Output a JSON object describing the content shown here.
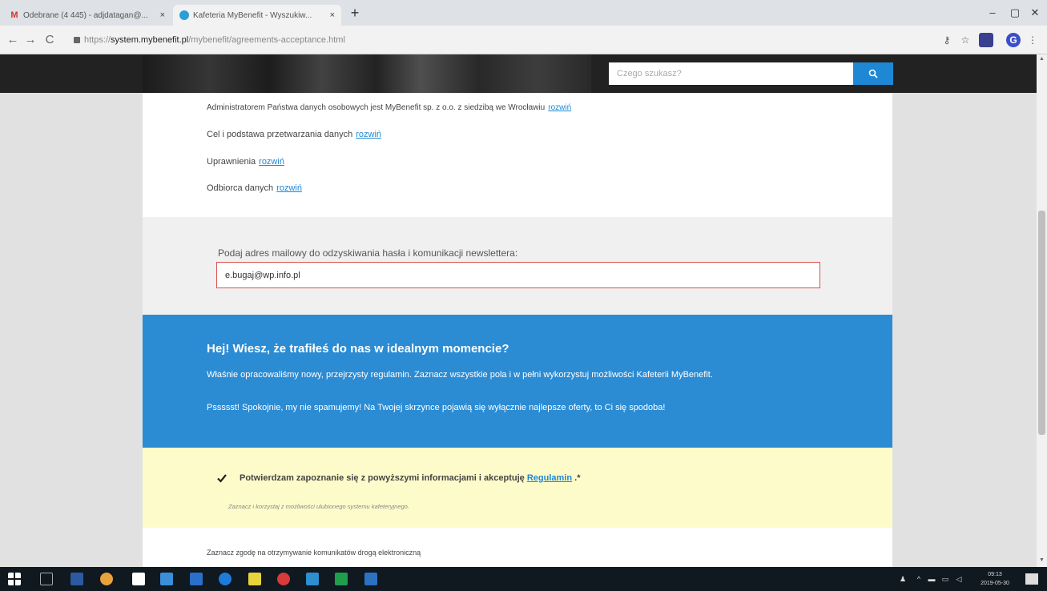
{
  "browser": {
    "tabs": [
      {
        "title": "Odebrane (4 445) - adjdatagan@...",
        "close": "×"
      },
      {
        "title": "Kafeteria MyBenefit - Wyszukiw...",
        "close": "×"
      }
    ],
    "new_tab": "+",
    "window_controls": {
      "minimize": "–",
      "maximize": "▢",
      "close": "✕"
    },
    "nav": {
      "back": "←",
      "forward": "→",
      "reload": "C"
    },
    "url_scheme": "https://",
    "url_host": "system.mybenefit.pl",
    "url_path": "/mybenefit/agreements-acceptance.html"
  },
  "header": {
    "search": {
      "placeholder": "Czego szukasz?",
      "value": ""
    }
  },
  "info": {
    "administrator_text": "Administratorem Państwa danych osobowych jest MyBenefit sp. z o.o. z siedzibą we Wrocławiu",
    "purpose_text": "Cel i podstawa przetwarzania danych",
    "rights_text": "Uprawnienia",
    "recipients_text": "Odbiorca danych",
    "expand_link": "rozwiń"
  },
  "email": {
    "label": "Podaj adres mailowy do odzyskiwania hasła i komunikacji newslettera:",
    "value": "e.bugaj@wp.info.pl"
  },
  "hey": {
    "title": "Hej! Wiesz, że trafiłeś do nas w idealnym momencie?",
    "paragraph1": "Właśnie opracowaliśmy nowy, przejrzysty regulamin. Zaznacz wszystkie pola i w pełni wykorzystuj możliwości Kafeterii MyBenefit.",
    "paragraph2": "Pssssst! Spokojnie, my nie spamujemy! Na Twojej skrzynce pojawią się wyłącznie najlepsze oferty, to Ci się spodoba!"
  },
  "confirm": {
    "text": "Potwierdzam zapoznanie się z powyższymi informacjami i akceptuję",
    "link": "Regulamin",
    "suffix": " .*",
    "note": "Zaznacz i korzystaj z możliwości ulubionego systemu kafeteryjnego.",
    "checked": true
  },
  "bottom": {
    "text": "Zaznacz zgodę na otrzymywanie komunikatów drogą elektroniczną"
  },
  "taskbar": {
    "time": "09:13",
    "date": "2019-05-30",
    "tray_up": "^"
  },
  "colors": {
    "accent_blue": "#2b8bd3",
    "search_button": "#1e88d4",
    "confirm_bg": "#fdfbc9",
    "header_bg": "#222222",
    "error_border": "#d9534f"
  }
}
